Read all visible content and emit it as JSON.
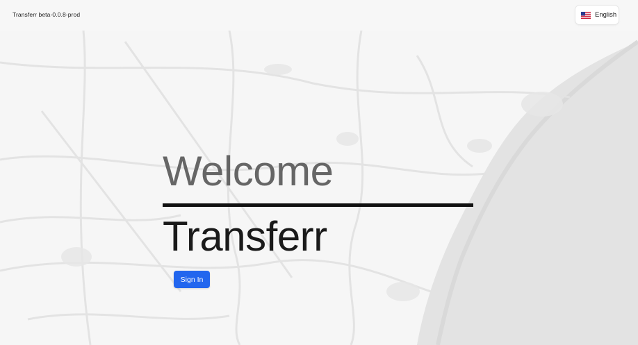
{
  "header": {
    "version_label": "Transferr beta-0.0.8-prod",
    "language": {
      "label": "English",
      "flag_icon": "us-flag-icon"
    }
  },
  "hero": {
    "welcome": "Welcome",
    "app_name": "Transferr"
  },
  "actions": {
    "sign_in_label": "Sign In"
  },
  "colors": {
    "accent": "#2266ee",
    "welcome_text": "#666666",
    "title_text": "#1a1a1a",
    "background": "#f6f6f6"
  }
}
